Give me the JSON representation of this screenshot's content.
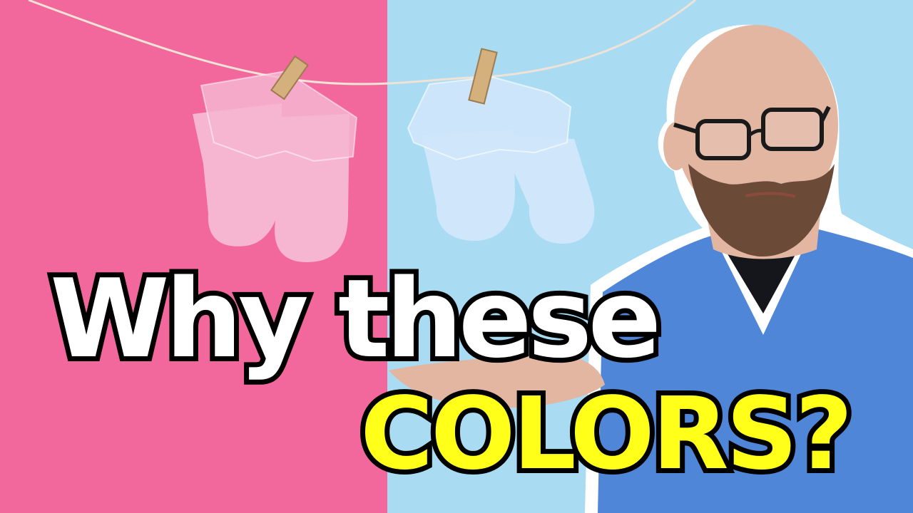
{
  "thumbnail": {
    "headline_line1": "Why these",
    "headline_line2": "COLORS?"
  },
  "colors": {
    "left_background": "#f2679c",
    "right_background": "#a9dcf3",
    "pink_socks": "#f6b6d1",
    "blue_socks": "#cfe6fb",
    "clothespin": "#d4b07c",
    "shirt": "#4f86d8",
    "skin": "#e3b6a2",
    "beard": "#6c4a38",
    "headline_line1_fill": "#ffffff",
    "headline_line2_fill": "#ffff1a",
    "headline_stroke": "#000000"
  },
  "icons": [
    "pink-socks-icon",
    "blue-socks-icon",
    "clothespin-icon",
    "person-icon",
    "glasses-icon"
  ]
}
